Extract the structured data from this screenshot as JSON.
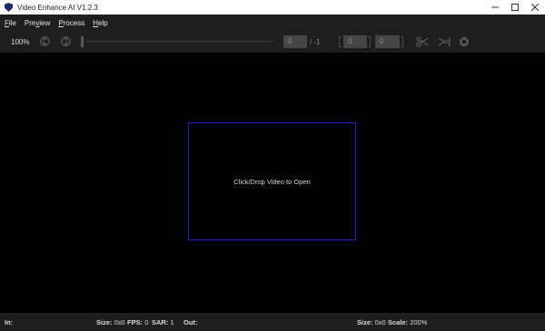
{
  "window": {
    "title": "Video Enhance AI V1.2.3",
    "minimize_glyph": "—",
    "maximize_glyph": "☐",
    "close_glyph": "✕"
  },
  "menu": {
    "items": [
      {
        "underlined": "F",
        "rest": "ile"
      },
      {
        "prefix": "Pre",
        "underlined": "v",
        "rest": "iew"
      },
      {
        "underlined": "P",
        "rest": "rocess"
      },
      {
        "underlined": "H",
        "rest": "elp"
      }
    ]
  },
  "toolbar": {
    "zoom": "100%",
    "buttons": [
      "skip-back-icon",
      "skip-forward-icon"
    ],
    "current_frame": "0",
    "total_frames": "/ -1",
    "range_start": "0",
    "range_end": "0",
    "tools": [
      "scissors-icon",
      "cut-right-icon",
      "stop-icon"
    ]
  },
  "canvas": {
    "drop_label": "Click/Drop Video to Open",
    "drop_border_color": "#1c1cd0"
  },
  "status": {
    "in_label": "In:",
    "size_label": "Size:",
    "size_value": "0x0",
    "fps_label": "FPS:",
    "fps_value": "0",
    "sar_label": "SAR:",
    "sar_value": "1",
    "out_label": "Out:",
    "out_size_label": "Size:",
    "out_size_value": "0x0",
    "scale_label": "Scale:",
    "scale_value": "200%"
  },
  "colors": {
    "background": "#000000",
    "chrome": "#1e1e1e",
    "titlebar": "#ffffff"
  }
}
